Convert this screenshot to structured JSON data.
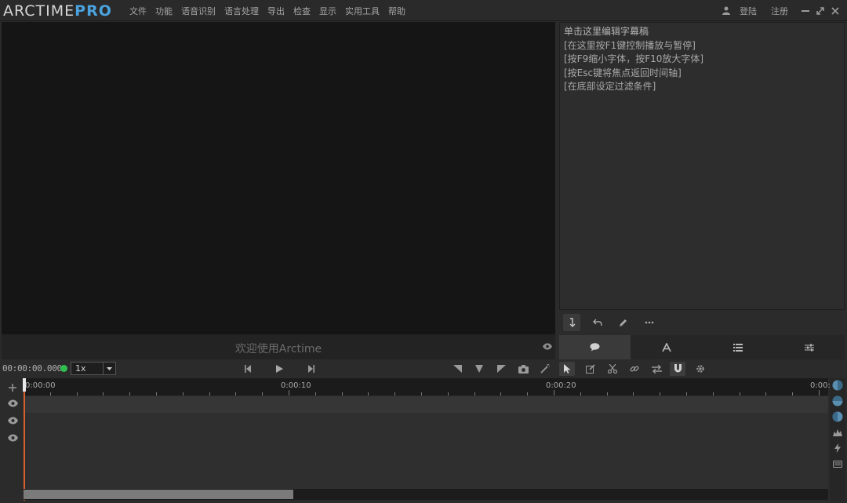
{
  "app": {
    "logo_main": "ARCTIME",
    "logo_suffix": "PRO"
  },
  "menu": [
    "文件",
    "功能",
    "语音识别",
    "语言处理",
    "导出",
    "检查",
    "显示",
    "实用工具",
    "帮助"
  ],
  "account": {
    "login": "登陆",
    "register": "注册"
  },
  "video": {
    "welcome": "欢迎使用Arctime"
  },
  "editor": {
    "lines": [
      "单击这里编辑字幕稿",
      "[在这里按F1键控制播放与暂停]",
      "[按F9缩小字体，按F10放大字体]",
      "[按Esc键将焦点返回时间轴]",
      "[在底部设定过滤条件]"
    ],
    "toolbar": [
      "insert-icon",
      "undo-icon",
      "pencil-icon",
      "more-icon"
    ],
    "tabs": [
      "comment-icon",
      "font-icon",
      "list-icon",
      "sliders-icon"
    ]
  },
  "transport": {
    "timecode": "00:00:00.000",
    "speed": "1x",
    "status_color": "#2fbf4f"
  },
  "timeline": {
    "ticks": [
      "0:00:00",
      "0:00:10",
      "0:00:20",
      "0:00:"
    ],
    "accent": "#d8612b"
  },
  "colors": {
    "brand": "#4aa3df",
    "background": "#2b2b2b"
  }
}
